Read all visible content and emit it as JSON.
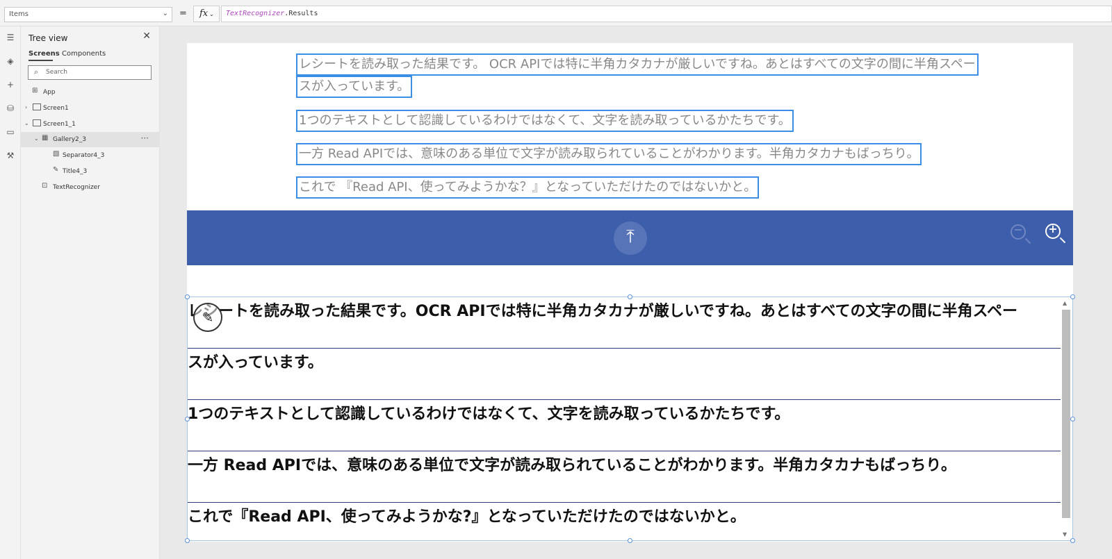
{
  "formula_bar": {
    "property": "Items",
    "equals": "=",
    "fx": "fx",
    "formula_object": "TextRecognizer",
    "formula_property": ".Results"
  },
  "tree": {
    "title": "Tree view",
    "tabs": [
      "Screens",
      "Components"
    ],
    "search_placeholder": "Search",
    "items": [
      {
        "label": "App"
      },
      {
        "label": "Screen1"
      },
      {
        "label": "Screen1_1"
      },
      {
        "label": "Gallery2_3"
      },
      {
        "label": "Separator4_3"
      },
      {
        "label": "Title4_3"
      },
      {
        "label": "TextRecognizer"
      }
    ]
  },
  "receipt": {
    "lines": [
      "レシートを読み取った結果です。 OCR APIでは特に半角カタカナが厳しいですね。あとはすべての文字の間に半角スペー",
      "スが入っています。",
      "1つのテキストとして認識しているわけではなくて、文字を読み取っているかたちです。",
      "一方 Read APIでは、意味のある単位で文字が読み取られていることがわかります。半角カタカナもばっちり。",
      "これで 『Read API、使ってみようかな？』となっていただけたのではないかと。"
    ]
  },
  "gallery": {
    "rows": [
      "レシートを読み取った結果です。OCR APIでは特に半角カタカナが厳しいですね。あとはすべての文字の間に半角スペー",
      "スが入っています。",
      "1つのテキストとして認識しているわけではなくて、文字を読み取っているかたちです。",
      "一方 Read APIでは、意味のある単位で文字が読み取られていることがわかります。半角カタカナもばっちり。",
      "これで『Read API、使ってみようかな?』となっていただけたのではないかと。"
    ]
  },
  "colors": {
    "toolbar": "#3d5eab",
    "ocr_box": "#3a8ee6",
    "separator": "#2e3a7a"
  }
}
